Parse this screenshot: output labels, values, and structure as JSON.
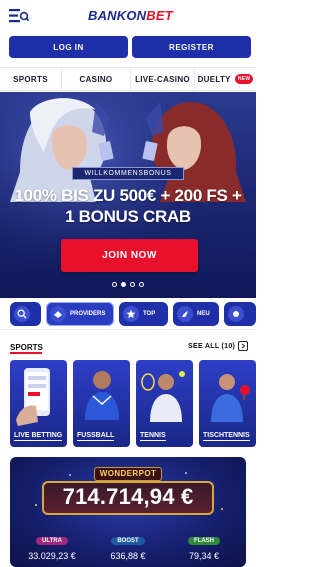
{
  "header": {
    "logo_part1": "BANKON",
    "logo_part2": "BET",
    "login_label": "LOG IN",
    "register_label": "REGISTER"
  },
  "nav": {
    "items": [
      {
        "label": "SPORTS"
      },
      {
        "label": "CASINO"
      },
      {
        "label": "LIVE-CASINO"
      },
      {
        "label": "DUELTY"
      }
    ],
    "new_badge": "NEW"
  },
  "hero": {
    "welcome": "WILLKOMMENSBONUS",
    "line1": "100% BIS ZU 500€ + 200 FS +",
    "line2": "1 BONUS CRAB",
    "cta": "JOIN NOW",
    "dots_count": 4,
    "active_dot": 1
  },
  "categories": [
    {
      "label": ""
    },
    {
      "label": "PROVIDERS"
    },
    {
      "label": "TOP"
    },
    {
      "label": "NEU"
    },
    {
      "label": ""
    }
  ],
  "sports": {
    "heading": "SPORTS",
    "see_all": "SEE ALL (10)",
    "tiles": [
      {
        "label": "LIVE BETTING"
      },
      {
        "label": "FUSSBALL"
      },
      {
        "label": "TENNIS"
      },
      {
        "label": "TISCHTENNIS"
      }
    ]
  },
  "wonderpot": {
    "title": "WONDERPOT",
    "amount": "714.714,94 €",
    "tiers": [
      {
        "name": "ULTRA",
        "value": "33.029,23 €"
      },
      {
        "name": "BOOST",
        "value": "636,88 €"
      },
      {
        "name": "FLASH",
        "value": "79,34 €"
      }
    ]
  },
  "colors": {
    "brand_blue": "#1f2fa8",
    "brand_red": "#e8102b"
  }
}
